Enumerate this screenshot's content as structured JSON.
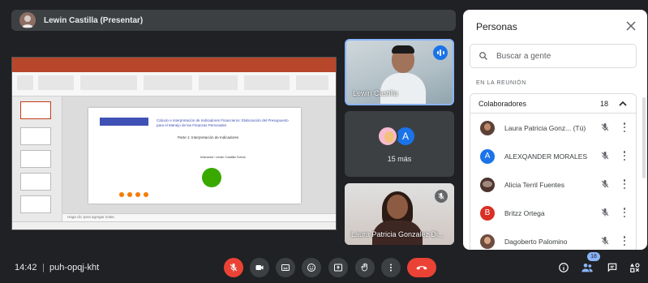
{
  "presenter": {
    "name": "Lewin Castilla (Presentar)"
  },
  "slide": {
    "title": "Cálculo e interpretación de Indicadores Financieros: Elaboración del Presupuesto para el Manejo de las Finanzas Personales",
    "subtitle": "Parte 1: Interpretación de Indicadores",
    "instructor": "Instructor: Lewin Castilla Torres",
    "notes_placeholder": "Haga clic para agregar notas"
  },
  "tiles": {
    "lewin": {
      "name": "Lewin Castilla"
    },
    "more": {
      "avatar_letter": "A",
      "count_label": "15 más"
    },
    "laura": {
      "name": "Laura Patricia Gonzalez Di..."
    }
  },
  "people_panel": {
    "title": "Personas",
    "search_placeholder": "Buscar a gente",
    "section_label": "EN LA REUNIÓN",
    "group": {
      "label": "Colaboradores",
      "count": "18"
    },
    "participants": [
      {
        "name": "Laura Patricia Gonz... (Tú)",
        "avatar": "",
        "avatar_color": "#5d4037"
      },
      {
        "name": "ALEXQANDER MORALES",
        "avatar": "A",
        "avatar_color": "#1a73e8"
      },
      {
        "name": "Alicia Terril Fuentes",
        "avatar": "",
        "avatar_color": "#4e342e"
      },
      {
        "name": "Britzz Ortega",
        "avatar": "B",
        "avatar_color": "#d93025"
      },
      {
        "name": "Dagoberto Palomino",
        "avatar": "",
        "avatar_color": "#6d4c41"
      }
    ]
  },
  "bottom": {
    "time": "14:42",
    "separator": "|",
    "meeting_code": "puh-opqj-kht",
    "people_badge": "18"
  },
  "colors": {
    "end_call": "#ea4335",
    "accent": "#8ab4f8",
    "blue": "#1a73e8"
  }
}
